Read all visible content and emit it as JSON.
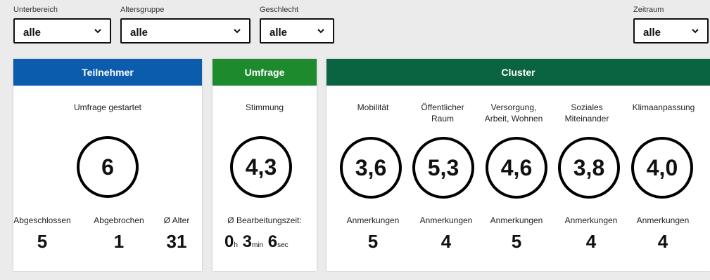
{
  "filters": [
    {
      "label": "Unterbereich",
      "value": "alle"
    },
    {
      "label": "Altersgruppe",
      "value": "alle"
    },
    {
      "label": "Geschlecht",
      "value": "alle"
    },
    {
      "label": "Zeitraum",
      "value": "alle"
    }
  ],
  "teilnehmer": {
    "title": "Teilnehmer",
    "color": "#0b5cad",
    "subtitle": "Umfrage gestartet",
    "value": "6",
    "stats": [
      {
        "label": "Abgeschlossen",
        "value": "5"
      },
      {
        "label": "Abgebrochen",
        "value": "1"
      },
      {
        "label": "Ø Alter",
        "value": "31"
      }
    ]
  },
  "umfrage": {
    "title": "Umfrage",
    "color": "#1e8a2e",
    "subtitle": "Stimmung",
    "value": "4,3",
    "time_label": "Ø Bearbeitungszeit:",
    "time": {
      "h": "0",
      "h_unit": "h",
      "min": "3",
      "min_unit": "min",
      "sec": "6",
      "sec_unit": "sec"
    }
  },
  "cluster": {
    "title": "Cluster",
    "color": "#0b6441",
    "items": [
      {
        "name": "Mobilität",
        "value": "3,6",
        "note_label": "Anmerkungen",
        "notes": "5"
      },
      {
        "name": "Öffentlicher Raum",
        "value": "5,3",
        "note_label": "Anmerkungen",
        "notes": "4"
      },
      {
        "name": "Versorgung, Arbeit, Wohnen",
        "value": "4,6",
        "note_label": "Anmerkungen",
        "notes": "5"
      },
      {
        "name": "Soziales Miteinander",
        "value": "3,8",
        "note_label": "Anmerkungen",
        "notes": "4"
      },
      {
        "name": "Klimaanpassung",
        "value": "4,0",
        "note_label": "Anmerkungen",
        "notes": "4"
      }
    ]
  }
}
